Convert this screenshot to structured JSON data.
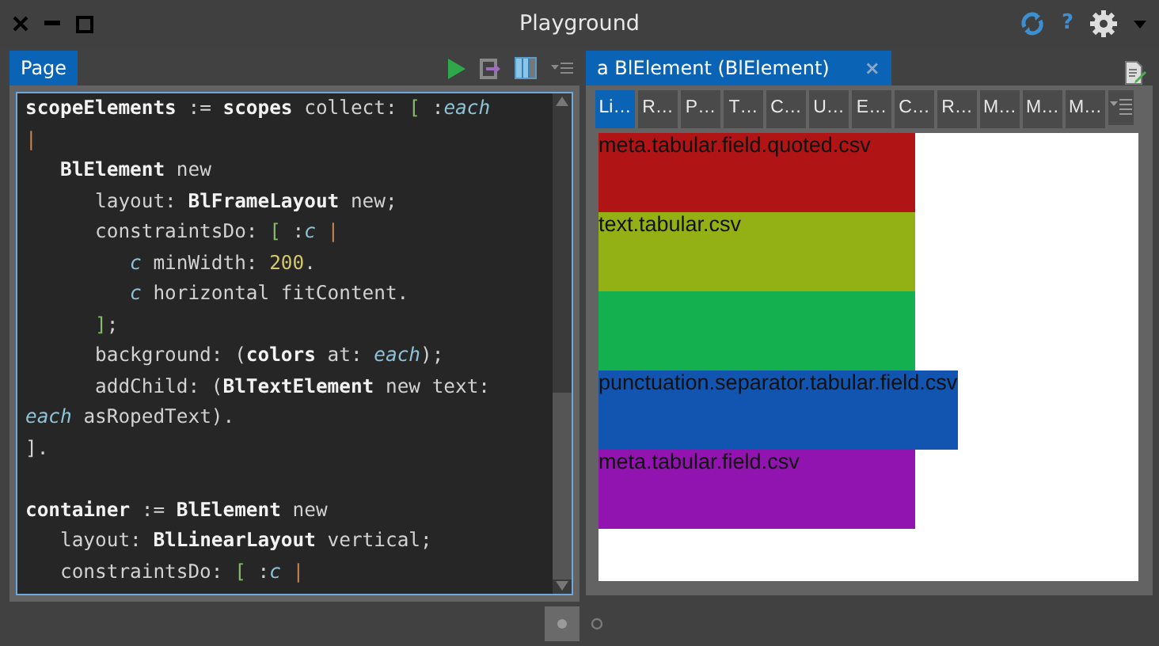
{
  "window": {
    "title": "Playground",
    "help": "?"
  },
  "left_pane": {
    "tab": {
      "label": "Page",
      "selected": true
    },
    "code_lines": [
      {
        "gap_after": false,
        "segments": [
          {
            "kind": "bold",
            "text": "scopeElements"
          },
          {
            "kind": "plain",
            "text": " := "
          },
          {
            "kind": "bold",
            "text": "scopes"
          },
          {
            "kind": "plain",
            "text": " collect: "
          },
          {
            "kind": "bracket",
            "text": "["
          },
          {
            "kind": "plain",
            "text": " :"
          },
          {
            "kind": "var",
            "text": "each"
          }
        ]
      },
      {
        "gap_after": false,
        "segments": [
          {
            "kind": "bar",
            "text": "|"
          }
        ]
      },
      {
        "gap_after": false,
        "segments": [
          {
            "kind": "bold",
            "text": "   BlElement"
          },
          {
            "kind": "plain",
            "text": " new"
          }
        ]
      },
      {
        "gap_after": false,
        "segments": [
          {
            "kind": "plain",
            "text": "      layout: "
          },
          {
            "kind": "bold",
            "text": "BlFrameLayout"
          },
          {
            "kind": "plain",
            "text": " new;"
          }
        ]
      },
      {
        "gap_after": false,
        "segments": [
          {
            "kind": "plain",
            "text": "      constraintsDo: "
          },
          {
            "kind": "bracket",
            "text": "["
          },
          {
            "kind": "plain",
            "text": " :"
          },
          {
            "kind": "var",
            "text": "c"
          },
          {
            "kind": "bar",
            "text": " |"
          }
        ]
      },
      {
        "gap_after": false,
        "segments": [
          {
            "kind": "var",
            "text": "         c"
          },
          {
            "kind": "plain",
            "text": " minWidth: "
          },
          {
            "kind": "num",
            "text": "200"
          },
          {
            "kind": "plain",
            "text": "."
          }
        ]
      },
      {
        "gap_after": false,
        "segments": [
          {
            "kind": "var",
            "text": "         c"
          },
          {
            "kind": "plain",
            "text": " horizontal fitContent."
          }
        ]
      },
      {
        "gap_after": false,
        "segments": [
          {
            "kind": "bracket",
            "text": "      ]"
          },
          {
            "kind": "plain",
            "text": ";"
          }
        ]
      },
      {
        "gap_after": false,
        "segments": [
          {
            "kind": "plain",
            "text": "      background: ("
          },
          {
            "kind": "bold",
            "text": "colors"
          },
          {
            "kind": "plain",
            "text": " at: "
          },
          {
            "kind": "var",
            "text": "each"
          },
          {
            "kind": "plain",
            "text": ");"
          }
        ]
      },
      {
        "gap_after": false,
        "segments": [
          {
            "kind": "plain",
            "text": "      addChild: ("
          },
          {
            "kind": "bold",
            "text": "BlTextElement"
          },
          {
            "kind": "plain",
            "text": " new text:"
          }
        ]
      },
      {
        "gap_after": false,
        "segments": [
          {
            "kind": "var",
            "text": "each"
          },
          {
            "kind": "plain",
            "text": " asRopedText)."
          }
        ]
      },
      {
        "gap_after": true,
        "segments": [
          {
            "kind": "plain",
            "text": "]."
          }
        ]
      },
      {
        "gap_after": false,
        "segments": [
          {
            "kind": "bold",
            "text": "container"
          },
          {
            "kind": "plain",
            "text": " := "
          },
          {
            "kind": "bold",
            "text": "BlElement"
          },
          {
            "kind": "plain",
            "text": " new"
          }
        ]
      },
      {
        "gap_after": false,
        "segments": [
          {
            "kind": "plain",
            "text": "   layout: "
          },
          {
            "kind": "bold",
            "text": "BlLinearLayout"
          },
          {
            "kind": "plain",
            "text": " vertical;"
          }
        ]
      },
      {
        "gap_after": false,
        "segments": [
          {
            "kind": "plain",
            "text": "   constraintsDo: "
          },
          {
            "kind": "bracket",
            "text": "["
          },
          {
            "kind": "plain",
            "text": " :"
          },
          {
            "kind": "var",
            "text": "c"
          },
          {
            "kind": "bar",
            "text": " |"
          }
        ]
      }
    ]
  },
  "right_pane": {
    "tab": {
      "label": "a BlElement (BlElement)",
      "selected": true,
      "close": "×"
    },
    "view_tabs": [
      {
        "label": "Li…",
        "selected": true
      },
      {
        "label": "R…",
        "selected": false
      },
      {
        "label": "P…",
        "selected": false
      },
      {
        "label": "T…",
        "selected": false
      },
      {
        "label": "C…",
        "selected": false
      },
      {
        "label": "U…",
        "selected": false
      },
      {
        "label": "E…",
        "selected": false
      },
      {
        "label": "C…",
        "selected": false
      },
      {
        "label": "R…",
        "selected": false
      },
      {
        "label": "M…",
        "selected": false
      },
      {
        "label": "M…",
        "selected": false
      },
      {
        "label": "M…",
        "selected": false
      }
    ],
    "elements": [
      {
        "text": "meta.tabular.field.quoted.csv",
        "color": "#b01414"
      },
      {
        "text": "text.tabular.csv",
        "color": "#93b014"
      },
      {
        "color": "#14b04f"
      },
      {
        "text": "punctuation.separator.tabular.field.csv",
        "color": "#1155b0"
      },
      {
        "text": "meta.tabular.field.csv",
        "color": "#9114b0"
      }
    ]
  },
  "pager": [
    {
      "selected": true
    },
    {
      "selected": false
    }
  ]
}
